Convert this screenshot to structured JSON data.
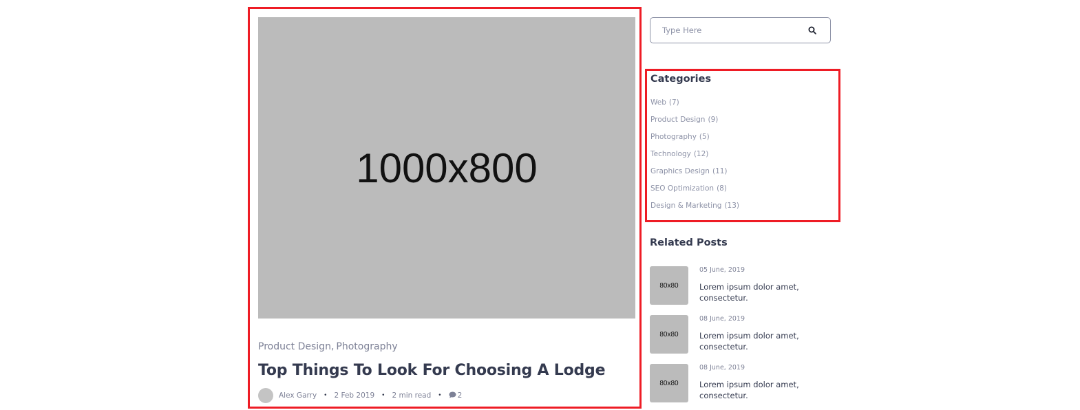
{
  "post": {
    "image_label": "1000x800",
    "categories": [
      "Product Design",
      "Photography"
    ],
    "title": "Top Things To Look For Choosing A Lodge",
    "author": "Alex Garry",
    "date": "2 Feb 2019",
    "read_time": "2 min read",
    "comments": "2"
  },
  "search": {
    "placeholder": "Type Here"
  },
  "categories_widget": {
    "title": "Categories",
    "items": [
      {
        "label": "Web",
        "count": "(7)"
      },
      {
        "label": "Product Design",
        "count": "(9)"
      },
      {
        "label": "Photography",
        "count": "(5)"
      },
      {
        "label": "Technology",
        "count": "(12)"
      },
      {
        "label": "Graphics Design",
        "count": "(11)"
      },
      {
        "label": "SEO Optimization",
        "count": "(8)"
      },
      {
        "label": "Design & Marketing",
        "count": "(13)"
      }
    ]
  },
  "related_posts": {
    "title": "Related Posts",
    "items": [
      {
        "thumb": "80x80",
        "date": "05 June, 2019",
        "text": "Lorem ipsum dolor amet, consectetur."
      },
      {
        "thumb": "80x80",
        "date": "08 June, 2019",
        "text": "Lorem ipsum dolor amet, consectetur."
      },
      {
        "thumb": "80x80",
        "date": "08 June, 2019",
        "text": "Lorem ipsum dolor amet, consectetur."
      }
    ]
  },
  "colors": {
    "highlight_border": "#ee1c25",
    "heading": "#343a4f",
    "muted": "#8c91a6",
    "placeholder_bg": "#bbbbbb"
  }
}
